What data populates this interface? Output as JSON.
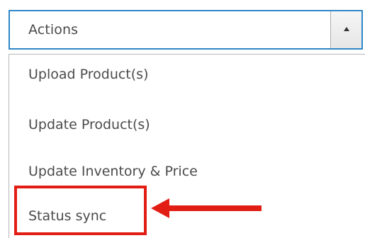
{
  "dropdown": {
    "selected_label": "Actions",
    "options": [
      {
        "label": "Upload Product(s)"
      },
      {
        "label": "Update Product(s)"
      },
      {
        "label": "Update Inventory & Price"
      },
      {
        "label": "Status sync"
      }
    ]
  },
  "annotation": {
    "highlighted_option": "Status sync",
    "color": "#e21d14"
  },
  "colors": {
    "focus_border": "#2e86c7",
    "text": "#4b4b4b"
  },
  "icons": {
    "toggle": "caret-up-icon",
    "pointer": "red-arrow-left-icon"
  }
}
